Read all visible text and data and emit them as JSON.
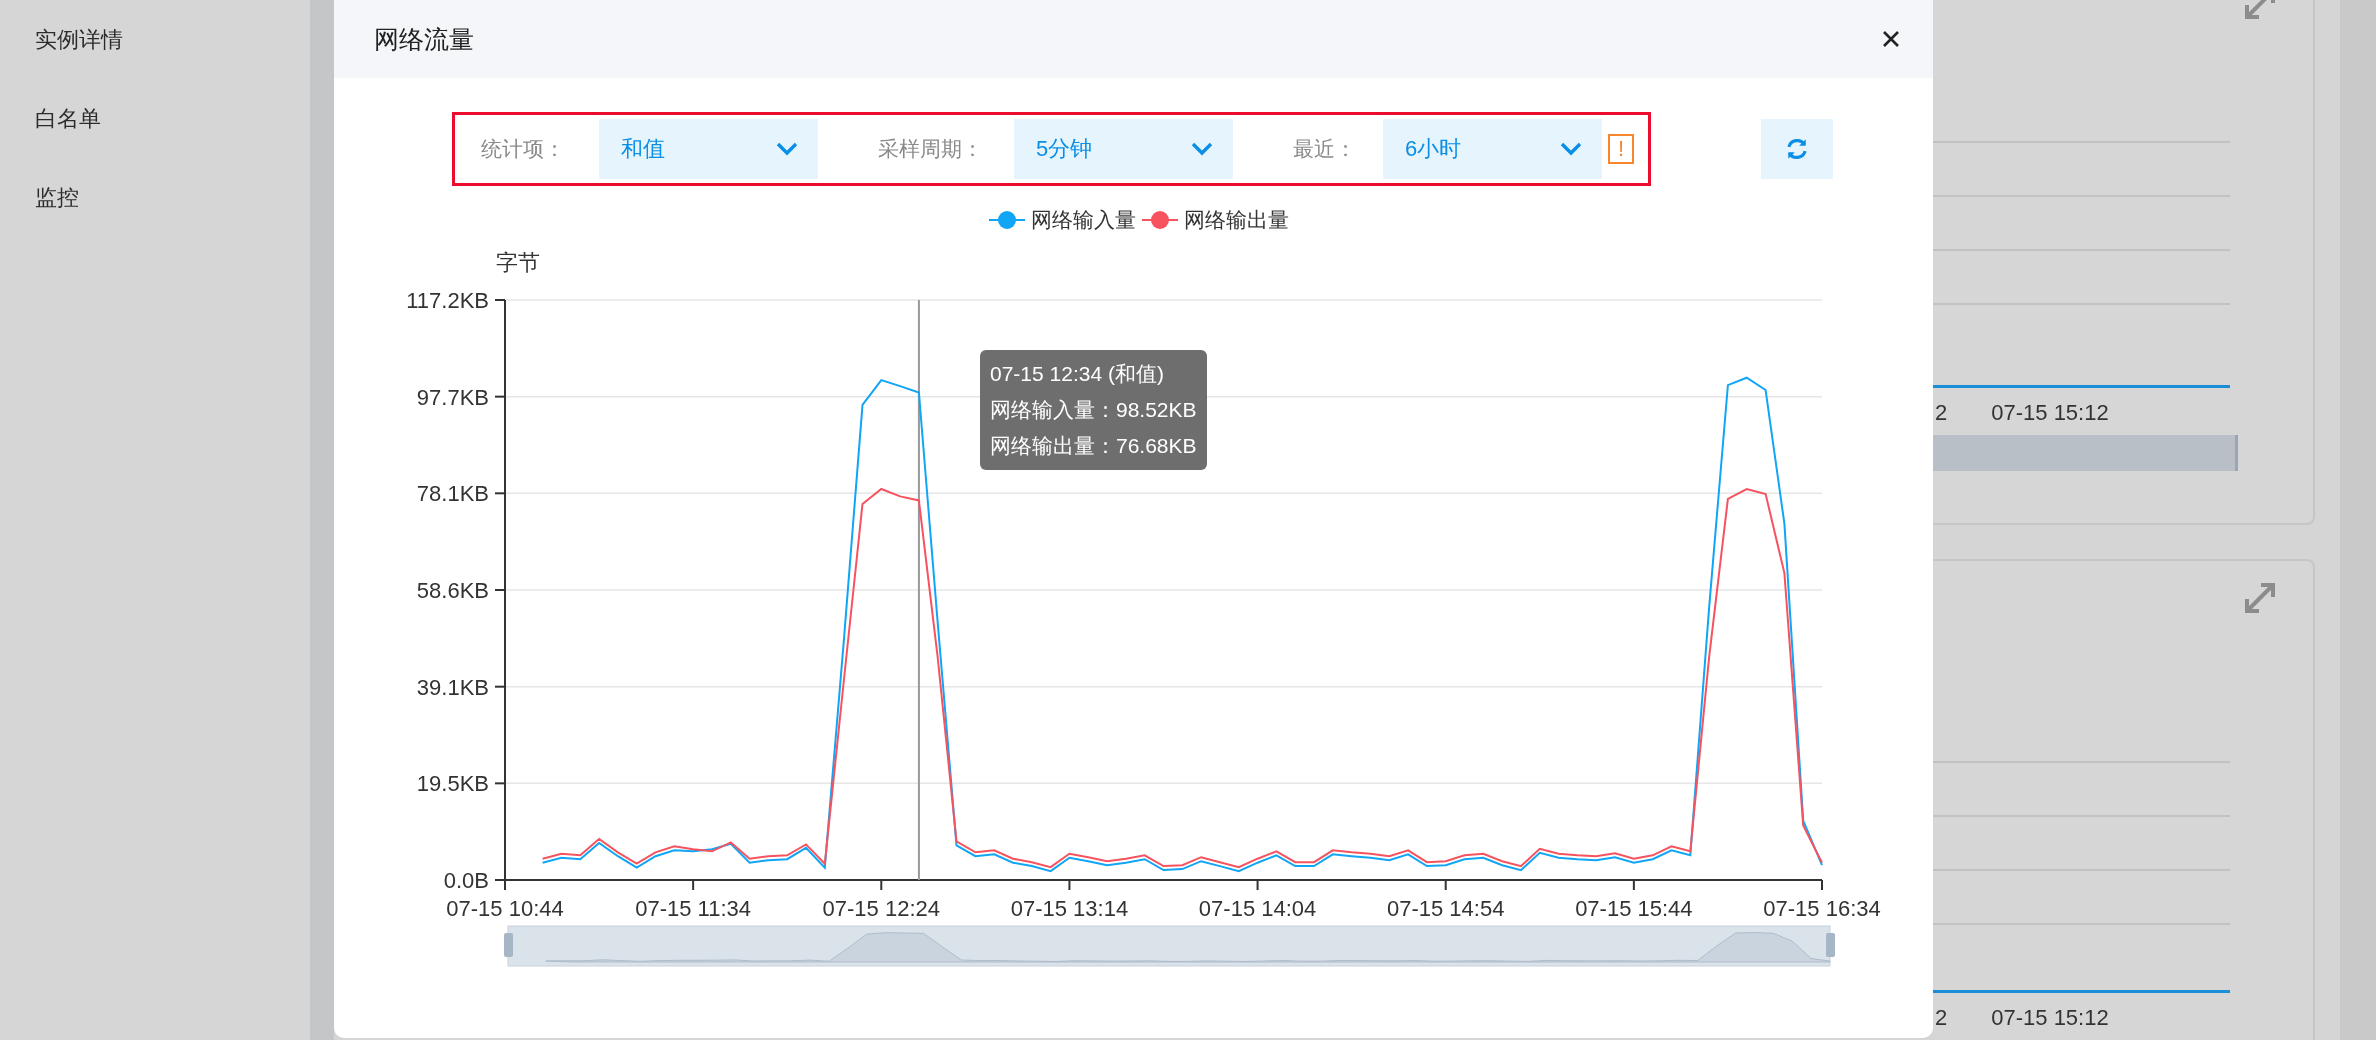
{
  "sidebar": {
    "items": [
      {
        "label": "实例详情"
      },
      {
        "label": "白名单"
      },
      {
        "label": "监控"
      }
    ]
  },
  "dialog": {
    "title": "网络流量",
    "filters": [
      {
        "label": "统计项：",
        "value": "和值"
      },
      {
        "label": "采样周期：",
        "value": "5分钟"
      },
      {
        "label": "最近：",
        "value": "6小时"
      }
    ],
    "warning": "!",
    "chart_data": {
      "type": "line",
      "ylabel": "字节",
      "categories": [
        "07-15 10:44",
        null,
        null,
        null,
        null,
        null,
        null,
        null,
        null,
        null,
        "07-15 11:34",
        null,
        null,
        null,
        null,
        null,
        null,
        null,
        null,
        null,
        "07-15 12:24",
        null,
        null,
        null,
        null,
        null,
        null,
        null,
        null,
        null,
        "07-15 13:14",
        null,
        null,
        null,
        null,
        null,
        null,
        null,
        null,
        null,
        "07-15 14:04",
        null,
        null,
        null,
        null,
        null,
        null,
        null,
        null,
        null,
        "07-15 14:54",
        null,
        null,
        null,
        null,
        null,
        null,
        null,
        null,
        null,
        "07-15 15:44",
        null,
        null,
        null,
        null,
        null,
        null,
        null,
        null,
        null,
        "07-15 16:34"
      ],
      "series": [
        {
          "name": "网络输入量",
          "color": "#10a5f5",
          "values": [
            null,
            null,
            3.5,
            4.5,
            4.2,
            7.5,
            4.8,
            2.5,
            4.8,
            6,
            5.8,
            6.2,
            7.3,
            3.5,
            4,
            4.2,
            6.5,
            2.5,
            48,
            96,
            101,
            99.8,
            98.5,
            52,
            7,
            4.8,
            5.2,
            3.5,
            2.8,
            1.8,
            4.5,
            3.8,
            3,
            3.5,
            4.2,
            2,
            2.2,
            3.8,
            2.8,
            1.8,
            3.5,
            5,
            2.8,
            2.8,
            5.2,
            4.8,
            4.5,
            4,
            5.2,
            2.8,
            3,
            4.2,
            4.5,
            3,
            2,
            5.5,
            4.5,
            4.2,
            4,
            4.6,
            3.5,
            4.2,
            6,
            5,
            55,
            100,
            101.5,
            99,
            72,
            12,
            3
          ]
        },
        {
          "name": "网络输出量",
          "color": "#f6535f",
          "values": [
            null,
            null,
            4.3,
            5.3,
            5,
            8.3,
            5.6,
            3.3,
            5.6,
            6.8,
            6.2,
            5.8,
            7.6,
            4.3,
            4.8,
            5,
            7.2,
            3.3,
            40,
            76,
            79,
            77.5,
            76.7,
            45,
            7.8,
            5.6,
            6,
            4.3,
            3.6,
            2.6,
            5.3,
            4.6,
            3.8,
            4.3,
            5,
            2.8,
            3,
            4.6,
            3.6,
            2.6,
            4.3,
            5.8,
            3.6,
            3.6,
            6,
            5.6,
            5.3,
            4.8,
            6,
            3.6,
            3.8,
            5,
            5.3,
            3.8,
            2.8,
            6.3,
            5.3,
            5,
            4.8,
            5.4,
            4.3,
            5,
            6.8,
            5.8,
            45,
            77,
            79,
            78,
            62,
            11,
            3.5
          ]
        }
      ],
      "ylim": [
        0,
        117.19
      ],
      "yticks": [
        {
          "value": 0,
          "label": "0.0B"
        },
        {
          "value": 19.53,
          "label": "19.5KB"
        },
        {
          "value": 39.06,
          "label": "39.1KB"
        },
        {
          "value": 58.59,
          "label": "58.6KB"
        },
        {
          "value": 78.13,
          "label": "78.1KB"
        },
        {
          "value": 97.66,
          "label": "97.7KB"
        },
        {
          "value": 117.19,
          "label": "117.2KB"
        }
      ],
      "grid": true
    },
    "tooltip": {
      "title": "07-15 12:34 (和值)",
      "lines": [
        "网络输入量：98.52KB",
        "网络输出量：76.68KB"
      ]
    }
  },
  "background_cards": [
    {
      "x_labels": [
        "2",
        "07-15 15:12"
      ]
    },
    {
      "x_labels": [
        "2",
        "07-15 15:12"
      ]
    }
  ]
}
